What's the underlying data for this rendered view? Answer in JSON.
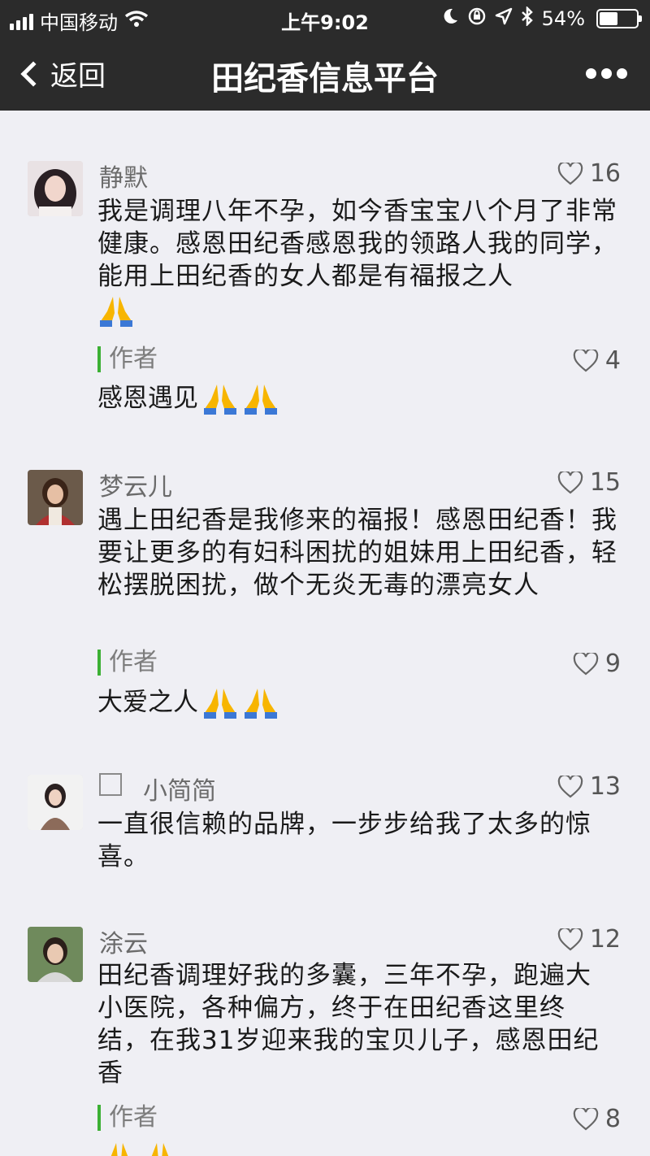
{
  "status_bar": {
    "carrier": "中国移动",
    "time": "上午9:02",
    "battery": "54%",
    "battery_level": 0.54
  },
  "nav": {
    "back_label": "返回",
    "title": "田纪香信息平台"
  },
  "comments": [
    {
      "name": "静默",
      "likes": "16",
      "text": "我是调理八年不孕，如今香宝宝八个月了非常健康。感恩田纪香感恩我的领路人我的同学，能用上田纪香的女人都是有福报之人",
      "reply": {
        "label": "作者",
        "likes": "4",
        "text": "感恩遇见"
      }
    },
    {
      "name": "梦云儿",
      "likes": "15",
      "text": "遇上田纪香是我修来的福报！感恩田纪香！我要让更多的有妇科困扰的姐妹用上田纪香，轻松摆脱困扰，做个无炎无毒的漂亮女人",
      "reply": {
        "label": "作者",
        "likes": "9",
        "text": "大爱之人"
      }
    },
    {
      "name": "小简简",
      "likes": "13",
      "text": "一直很信赖的品牌，一步步给我了太多的惊喜。"
    },
    {
      "name": "涂云",
      "likes": "12",
      "text": "田纪香调理好我的多囊，三年不孕，跑遍大小医院，各种偏方，终于在田纪香这里终结，在我31岁迎来我的宝贝儿子，感恩田纪香",
      "reply": {
        "label": "作者",
        "likes": "8",
        "text": ""
      }
    }
  ],
  "icons": {
    "like": "heart-outline-icon",
    "emoji": "folded-hands-icon"
  },
  "colors": {
    "bar_bg": "#2b2b2b",
    "page_bg": "#efeff4",
    "author_accent": "#3cb034",
    "name_text": "#6b6b6b"
  }
}
